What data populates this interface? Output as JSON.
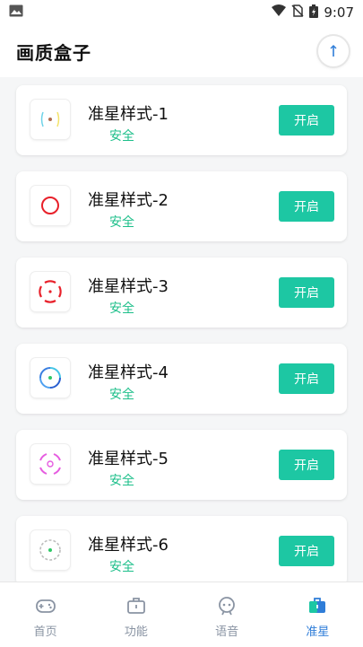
{
  "status_bar": {
    "time": "9:07"
  },
  "header": {
    "title": "画质盒子"
  },
  "cards": [
    {
      "title": "准星样式-1",
      "subtitle": "安全",
      "button": "开启",
      "icon": "crosshair-style-1"
    },
    {
      "title": "准星样式-2",
      "subtitle": "安全",
      "button": "开启",
      "icon": "crosshair-style-2"
    },
    {
      "title": "准星样式-3",
      "subtitle": "安全",
      "button": "开启",
      "icon": "crosshair-style-3"
    },
    {
      "title": "准星样式-4",
      "subtitle": "安全",
      "button": "开启",
      "icon": "crosshair-style-4"
    },
    {
      "title": "准星样式-5",
      "subtitle": "安全",
      "button": "开启",
      "icon": "crosshair-style-5"
    },
    {
      "title": "准星样式-6",
      "subtitle": "安全",
      "button": "开启",
      "icon": "crosshair-style-6"
    }
  ],
  "nav": [
    {
      "label": "首页",
      "icon": "gamepad-icon"
    },
    {
      "label": "功能",
      "icon": "briefcase-icon"
    },
    {
      "label": "语音",
      "icon": "robot-icon"
    },
    {
      "label": "准星",
      "icon": "briefcase-icon",
      "active": true
    }
  ],
  "colors": {
    "accent": "#1dc7a3",
    "safe_text": "#1dbf8a",
    "nav_active": "#2f7dd8"
  }
}
